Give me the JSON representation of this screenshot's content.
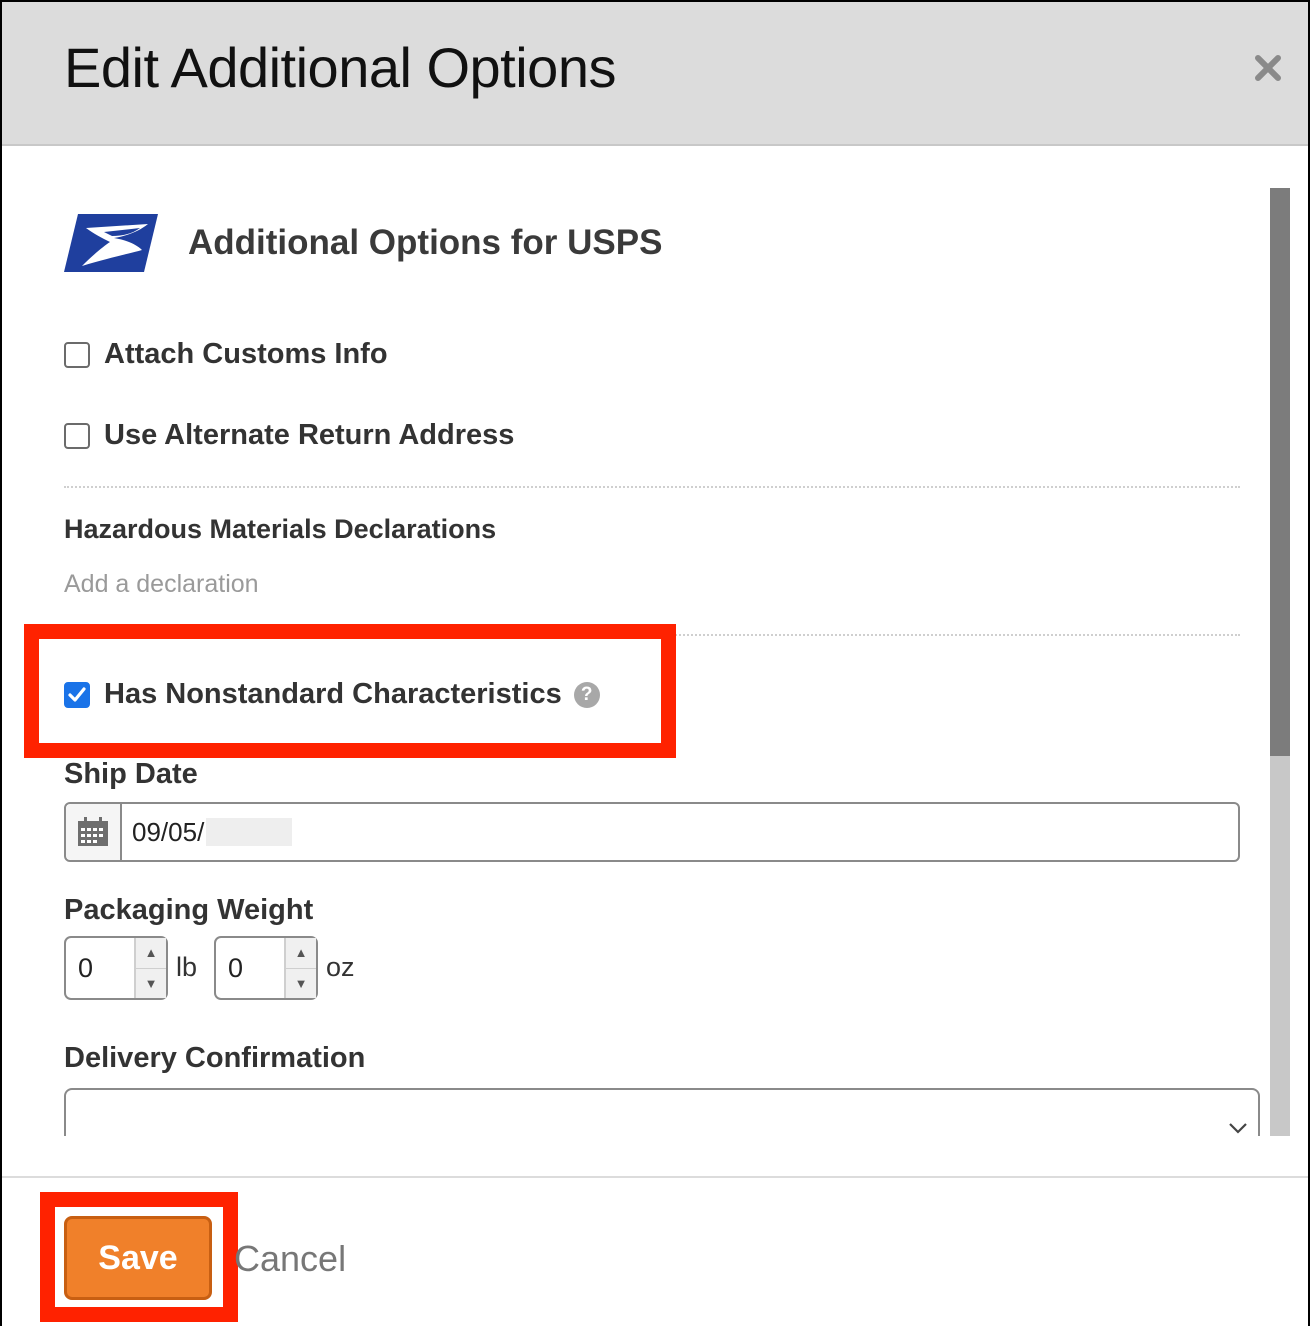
{
  "modal": {
    "title": "Edit Additional Options",
    "close_icon": "close-icon"
  },
  "carrier": {
    "logo_icon": "usps-eagle-logo",
    "title": "Additional Options for USPS"
  },
  "options": {
    "attach_customs": {
      "label": "Attach Customs Info",
      "checked": false
    },
    "alternate_return": {
      "label": "Use Alternate Return Address",
      "checked": false
    }
  },
  "hazmat": {
    "title": "Hazardous Materials Declarations",
    "add_link": "Add a declaration"
  },
  "nonstandard": {
    "label": "Has Nonstandard Characteristics",
    "checked": true,
    "help_glyph": "?"
  },
  "ship_date": {
    "label": "Ship Date",
    "value": "09/05/",
    "icon": "calendar-icon"
  },
  "packaging_weight": {
    "label": "Packaging Weight",
    "lb_value": "0",
    "lb_unit": "lb",
    "oz_value": "0",
    "oz_unit": "oz"
  },
  "delivery_confirmation": {
    "label": "Delivery Confirmation",
    "value": ""
  },
  "footer": {
    "save_label": "Save",
    "cancel_label": "Cancel"
  },
  "colors": {
    "accent": "#f0802a",
    "highlight": "#ff2200",
    "checkbox": "#1a73e8",
    "usps_blue": "#1f3f9e"
  }
}
